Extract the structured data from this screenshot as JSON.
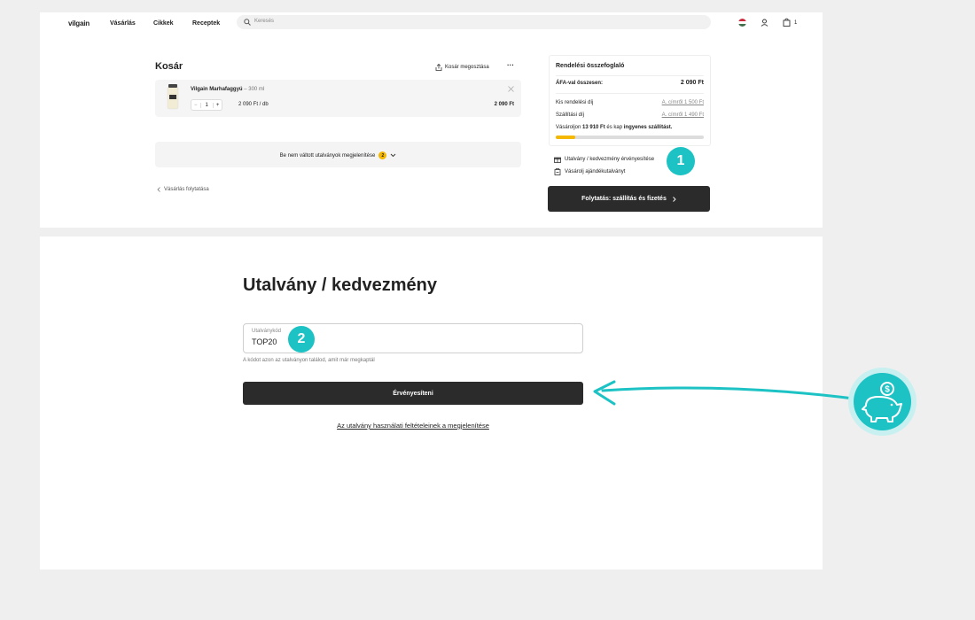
{
  "header": {
    "logo": "vilgain",
    "nav": [
      "Vásárlás",
      "Cikkek",
      "Receptek"
    ],
    "search_placeholder": "Keresés",
    "cart_count": "1"
  },
  "cart": {
    "title": "Kosár",
    "share_label": "Kosár megosztása",
    "item": {
      "name": "Vilgain Marhafaggyú",
      "variant": "– 300 ml",
      "quantity": "1",
      "unit_price": "2 090 Ft / db",
      "total": "2 090 Ft"
    },
    "vouchers_toggle": "Be nem váltott utalványok megjelenítése",
    "vouchers_count": "2",
    "continue_shopping": "Vásárlás folytatása"
  },
  "summary": {
    "title": "Rendelési összefoglaló",
    "total_label": "ÁFA-val összesen:",
    "total_value": "2 090 Ft",
    "rows": [
      {
        "label": "Kis rendelési díj",
        "value": "A. címről 1 500 Ft"
      },
      {
        "label": "Szállítási díj",
        "value": "A. címről 1 490 Ft"
      }
    ],
    "free_shipping_pre": "Vásároljon",
    "free_shipping_amount": "13 910 Ft",
    "free_shipping_mid": "és kap",
    "free_shipping_bold": "ingyenes szállítást.",
    "free_shipping_progress": 0.13,
    "voucher_link": "Utalvány / kedvezmény érvényesítése",
    "gift_link": "Vásárolj ajándékutalványt",
    "checkout_button": "Folytatás: szállítás és fizetés"
  },
  "voucher_dialog": {
    "title": "Utalvány / kedvezmény",
    "field_label": "Utalványkód",
    "field_value": "TOP20",
    "hint": "A kódot azon az utalványon találod, amit már megkaptál",
    "apply_button": "Érvényesíteni",
    "terms_link": "Az utalvány használati feltételeinek a megjelenítése"
  },
  "steps": [
    "1",
    "2"
  ],
  "colors": {
    "accent": "#1cc2c4",
    "dark": "#2b2b2b",
    "progress": "#f5b800"
  }
}
